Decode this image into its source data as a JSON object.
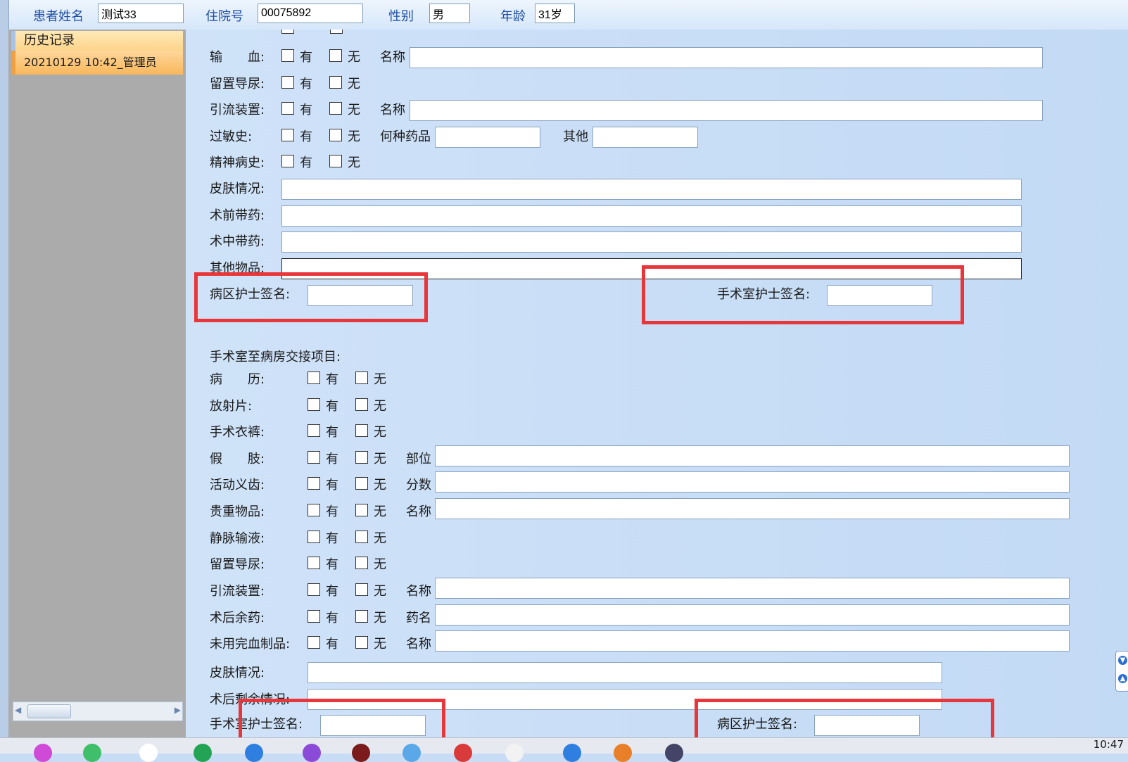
{
  "header": {
    "patient_name_label": "患者姓名",
    "patient_name_value": "测试33",
    "admission_no_label": "住院号",
    "admission_no_value": "00075892",
    "gender_label": "性别",
    "gender_value": "男",
    "age_label": "年龄",
    "age_value": "31岁"
  },
  "sidebar": {
    "header": "历史记录",
    "items": [
      "20210129 10:42_管理员"
    ]
  },
  "options": {
    "yes": "有",
    "no": "无"
  },
  "section1": {
    "rows": [
      {
        "label": "输　　血:",
        "extra_label": "名称"
      },
      {
        "label": "留置导尿:"
      },
      {
        "label": "引流装置:",
        "extra_label": "名称"
      },
      {
        "label": "过敏史:",
        "extra_label": "何种药品",
        "extra_label2": "其他"
      },
      {
        "label": "精神病史:"
      }
    ],
    "text_rows": [
      "皮肤情况:",
      "术前带药:",
      "术中带药:",
      "其他物品:"
    ],
    "ward_nurse_sign": "病区护士签名:",
    "or_nurse_sign": "手术室护士签名:"
  },
  "section2": {
    "title": "手术室至病房交接项目:",
    "rows": [
      {
        "label": "病　　历:"
      },
      {
        "label": "放射片:"
      },
      {
        "label": "手术衣裤:"
      },
      {
        "label": "假　　肢:",
        "extra_label": "部位"
      },
      {
        "label": "活动义齿:",
        "extra_label": "分数"
      },
      {
        "label": "贵重物品:",
        "extra_label": "名称"
      },
      {
        "label": "静脉输液:"
      },
      {
        "label": "留置导尿:"
      },
      {
        "label": "引流装置:",
        "extra_label": "名称"
      },
      {
        "label": "术后余药:",
        "extra_label": "药名"
      },
      {
        "label": "未用完血制品:",
        "extra_label": "名称"
      }
    ],
    "text_rows": [
      "皮肤情况:",
      "术后剩余情况:"
    ],
    "or_nurse_sign": "手术室护士签名:",
    "ward_nurse_sign": "病区护士签名:"
  },
  "taskbar": {
    "clock": "10:47"
  }
}
